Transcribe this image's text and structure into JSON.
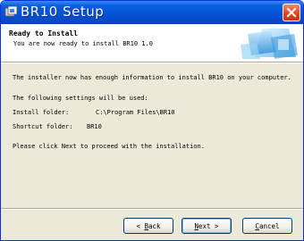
{
  "window": {
    "title": "BR10 Setup",
    "close_label": "Close"
  },
  "header": {
    "title": "Ready to Install",
    "subtitle": "You are now ready to install BR10 1.0"
  },
  "content": {
    "intro": "The installer now has enough information to install BR10 on your computer.",
    "settings_heading": "The following settings will be used:",
    "install_folder_label": "Install folder:",
    "install_folder_value": "C:\\Program Files\\BR10",
    "shortcut_folder_label": "Shortcut folder:",
    "shortcut_folder_value": "BR10",
    "instruction": "Please click Next to proceed with the installation."
  },
  "buttons": {
    "back": {
      "prefix": "< ",
      "mnemonic": "B",
      "rest": "ack"
    },
    "next": {
      "mnemonic": "N",
      "rest": "ext",
      "suffix": " >"
    },
    "cancel": {
      "mnemonic": "C",
      "rest": "ancel"
    }
  },
  "icons": {
    "app": "setup-app-icon",
    "close": "close-x-icon",
    "header_graphic": "installer-banner-graphic"
  },
  "colors": {
    "titlebar": "#0553d6",
    "dialog_background": "#ece9d8",
    "close_button": "#e2411c"
  }
}
